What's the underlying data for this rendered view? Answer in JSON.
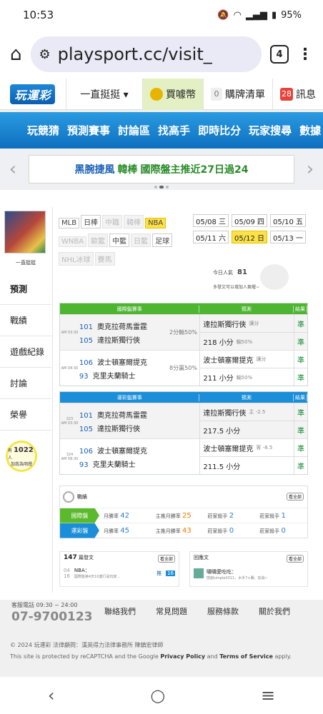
{
  "status": {
    "time": "10:53",
    "battery": "95%"
  },
  "browser": {
    "url": "playsport.cc/visit_",
    "tabs": "4"
  },
  "topnav": {
    "logo": "玩運彩",
    "user": "一直挺挺 ▾",
    "coin": "買噱幣",
    "cart_count": "0",
    "cart": "購牌清單",
    "msg_count": "28",
    "msg": "訊息"
  },
  "mainnav": [
    "玩競猜",
    "預測賽事",
    "討論區",
    "找高手",
    "即時比分",
    "玩家搜尋",
    "數據"
  ],
  "promo": {
    "text_a": "黑腕捷風",
    "text_b": "韓棒",
    "text_c": "國際盤主推近27日過24"
  },
  "colors": {
    "green": "#5aba2c",
    "blue": "#1a8ed8",
    "orange": "#f07a00",
    "yellow": "#fde247"
  },
  "side": {
    "username": "一直挺挺",
    "items": [
      "預測",
      "戰績",
      "遊戲紀錄",
      "討論",
      "榮譽"
    ],
    "bulb_pre": "有",
    "bulb_count": "1022",
    "bulb_unit": "人",
    "bulb_post": "加我為明燈"
  },
  "leagues": [
    {
      "l": "MLB",
      "s": "n"
    },
    {
      "l": "日棒",
      "s": "n"
    },
    {
      "l": "中職",
      "s": "d"
    },
    {
      "l": "韓棒",
      "s": "d"
    },
    {
      "l": "NBA",
      "s": "s"
    },
    {
      "l": "WNBA",
      "s": "d"
    },
    {
      "l": "歐籃",
      "s": "d"
    },
    {
      "l": "中籃",
      "s": "n"
    },
    {
      "l": "日籃",
      "s": "d"
    },
    {
      "l": "足球",
      "s": "n"
    },
    {
      "l": "NHL冰球",
      "s": "d"
    },
    {
      "l": "賽馬",
      "s": "d"
    }
  ],
  "dates": [
    {
      "l": "05/08 三",
      "s": "n"
    },
    {
      "l": "05/09 四",
      "s": "n"
    },
    {
      "l": "05/10 五",
      "s": "n"
    },
    {
      "l": "05/11 六",
      "s": "n"
    },
    {
      "l": "05/12 日",
      "s": "s"
    },
    {
      "l": "05/13 一",
      "s": "n"
    }
  ],
  "today": {
    "label": "今日人氣",
    "count": "81",
    "more": "多發文可以增加人氣喔~"
  },
  "intl": {
    "h1": "國際盤賽事",
    "h2": "預測",
    "h3": "結果",
    "rows": [
      {
        "time": "AM 03:30",
        "no1": "101",
        "t1": "奧克拉荷馬雷霆",
        "no2": "105",
        "t2": "達拉斯獨行俠",
        "spread": "2分輸50%",
        "p1": "達拉斯獨行俠",
        "p1s": "讓分",
        "p2": "218 小分",
        "p2s": "輸50%",
        "r1": "準",
        "r2": "準"
      },
      {
        "time": "AM 08:30",
        "no1": "106",
        "t1": "波士頓塞爾提克",
        "no2": "93",
        "t2": "克里夫蘭騎士",
        "spread": "8分贏50%",
        "p1": "波士頓塞爾提克",
        "p1s": "讓分",
        "p2": "211 小分",
        "p2s": "輸50%",
        "r1": "準",
        "r2": "準"
      }
    ]
  },
  "lottery": {
    "h1": "運彩盤賽事",
    "h2": "預測",
    "h3": "結果",
    "rows": [
      {
        "code": "323",
        "time": "AM 03:30",
        "no1": "101",
        "t1": "奧克拉荷馬雷霆",
        "no2": "105",
        "t2": "達拉斯獨行俠",
        "p1": "達拉斯獨行俠",
        "p1s": "主 -2.5",
        "p2": "217.5 小分",
        "r1": "準",
        "r2": "準"
      },
      {
        "code": "324",
        "time": "AM 08:30",
        "no1": "106",
        "t1": "波士頓塞爾提克",
        "no2": "93",
        "t2": "克里夫蘭騎士",
        "p1": "波士頓塞爾提克",
        "p1s": "客 -8.5",
        "p2": "211.5 小分",
        "r1": "準",
        "r2": "準"
      }
    ]
  },
  "stats": {
    "title": "戰績",
    "see": "看全部",
    "rows": [
      {
        "label": "國際盤",
        "c1a": "月勝率",
        "c1": "42",
        "c2a": "主推月勝率",
        "c2": "25",
        "c3a": "莊家殺手",
        "c3": "2",
        "c4a": "莊家殺手",
        "c4": "1"
      },
      {
        "label": "運彩盤",
        "c1a": "月勝率",
        "c1": "45",
        "c2a": "主推月勝率",
        "c2": "43",
        "c3a": "莊家殺手",
        "c3": "0",
        "c4a": "莊家殺手",
        "c4": "0"
      }
    ]
  },
  "posts": {
    "count": "147",
    "label": "篇發文",
    "see": "看全部",
    "date": "04",
    "mo": "16",
    "title": "NBA：",
    "excerpt": "國際盤第4天10連行是玩家...",
    "reply": "推",
    "reply_n": "16"
  },
  "recent": {
    "label": "回應文",
    "see": "看全部",
    "title": "嘯嘯愛吃吃：",
    "excerpt": "感謝simple0311，水手7+賽，加油~"
  },
  "footer": {
    "hotline": "客服電話 09:30 ~ 24:00",
    "phone": "07-9700123",
    "links": [
      "聯絡我們",
      "常見問題",
      "服務條款",
      "關於我們"
    ],
    "copyright": "© 2024 玩運彩 法律顧問：漢英得力法律事務所 陳鎮宏律師",
    "cap_a": "This site is protected by reCAPTCHA and the Google ",
    "cap_pp": "Privacy Policy",
    "cap_b": " and ",
    "cap_tos": "Terms of Service",
    "cap_c": " apply."
  }
}
